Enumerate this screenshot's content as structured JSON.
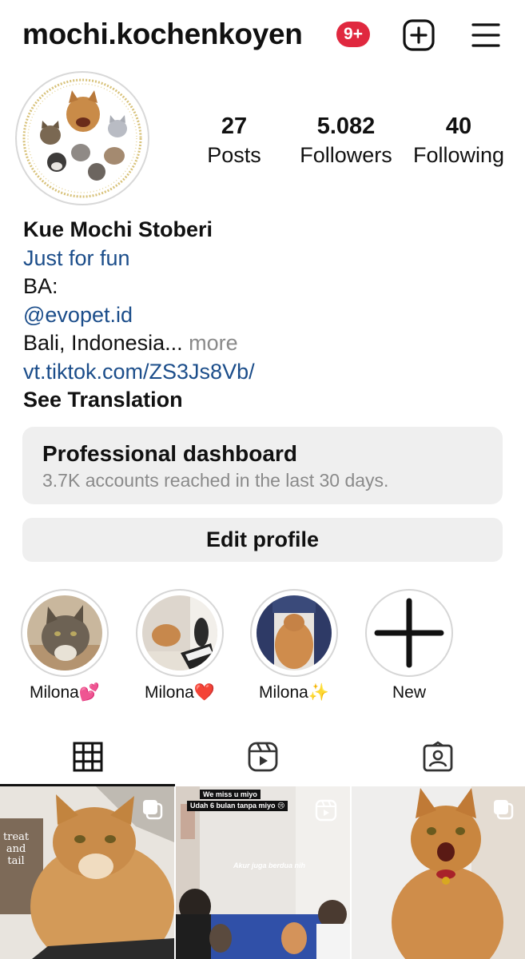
{
  "header": {
    "username": "mochi.kochenkoyen",
    "notification_badge": "9+",
    "badge_color": "#e0283f"
  },
  "stats": [
    {
      "value": "27",
      "label": "Posts"
    },
    {
      "value": "5.082",
      "label": "Followers"
    },
    {
      "value": "40",
      "label": "Following"
    }
  ],
  "bio": {
    "name": "Kue Mochi Stoberi",
    "category": "Just for fun",
    "line1": "BA:",
    "mention": "@evopet.id",
    "location": "Bali, Indonesia...",
    "more": " more",
    "link": "vt.tiktok.com/ZS3Js8Vb/",
    "translation": "See Translation",
    "link_color": "#1b4d8a"
  },
  "dashboard": {
    "title": "Professional dashboard",
    "subtitle": "3.7K accounts reached in the last 30 days."
  },
  "edit_profile_label": "Edit profile",
  "highlights": [
    {
      "label": "Milona💕"
    },
    {
      "label": "Milona❤️"
    },
    {
      "label": "Milona✨"
    },
    {
      "label": "New"
    }
  ],
  "tabs": [
    "grid-icon",
    "reels-icon",
    "tagged-icon"
  ],
  "posts": [
    {
      "overlay_text": "treat\nand\ntail",
      "icon": "multiple-photos-icon"
    },
    {
      "caption_top_1": "We miss u miyo",
      "caption_top_2": "Udah 6 bulan tanpa miyo 😢",
      "caption_mid": "Akur juga berdua nih",
      "icon": "reel-icon"
    },
    {
      "icon": "multiple-photos-icon"
    }
  ]
}
